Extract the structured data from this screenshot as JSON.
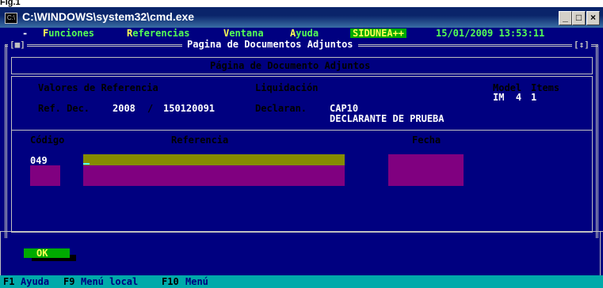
{
  "caption": "Fig.1",
  "window": {
    "title": "C:\\WINDOWS\\system32\\cmd.exe",
    "controls": [
      "_",
      "□",
      "×"
    ]
  },
  "menu": {
    "items": [
      {
        "hotkey": "F",
        "rest": "unciones"
      },
      {
        "hotkey": "R",
        "rest": "eferencias"
      },
      {
        "hotkey": "V",
        "rest": "entana"
      },
      {
        "hotkey": "A",
        "rest": "yuda"
      }
    ],
    "app": "SIDUNEA++",
    "datetime": "15/01/2009 13:53:11",
    "dash": "-"
  },
  "frame": {
    "title": "Pagina de Documentos Adjuntos",
    "left_button": "[■]",
    "right_button": "[↕]"
  },
  "form": {
    "panel_title": "Página de Documento Adjuntos",
    "valores_label": "Valores de Referencia",
    "liquidacion_label": "Liquidación",
    "model_label": "Model",
    "items_label": "Items",
    "model_value": "IM  4",
    "items_value": "1",
    "ref_label": "Ref. Dec.",
    "ref_year": "2008",
    "ref_slash": "/",
    "ref_number": "150120091",
    "declarant_label": "Declaran.",
    "declarant_code": "CAP10",
    "declarant_name": "DECLARANTE DE PRUEBA",
    "col_codigo": "Código",
    "col_referencia": "Referencia",
    "col_fecha": "Fecha",
    "row_codigo": "049"
  },
  "ok_button": "OK",
  "function_keys": [
    {
      "key": "F1",
      "label": "Ayuda"
    },
    {
      "key": "F9",
      "label": "Menú local"
    },
    {
      "key": "F10",
      "label": "Menú"
    }
  ],
  "colors": {
    "console_bg": "#000080",
    "olive_field": "#858b00",
    "magenta_field": "#800080",
    "ok_button": "#00aa00",
    "function_bar": "#00aaaa"
  }
}
